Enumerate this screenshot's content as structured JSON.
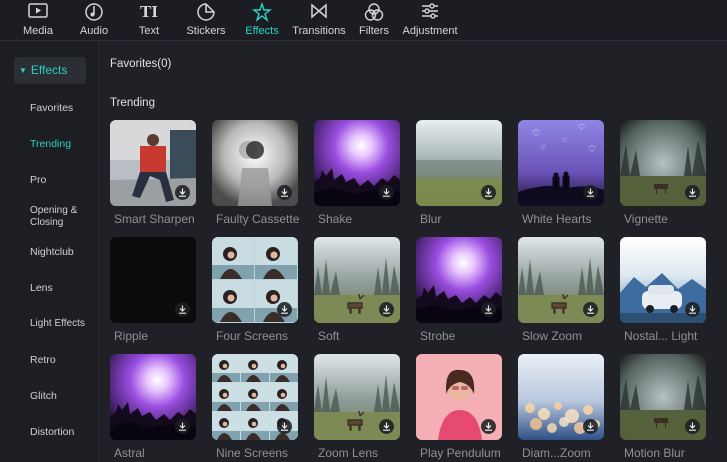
{
  "toolbar": {
    "tabs": [
      {
        "label": "Media",
        "icon": "media-icon"
      },
      {
        "label": "Audio",
        "icon": "audio-icon"
      },
      {
        "label": "Text",
        "icon": "text-icon"
      },
      {
        "label": "Stickers",
        "icon": "stickers-icon"
      },
      {
        "label": "Effects",
        "icon": "effects-icon",
        "active": true
      },
      {
        "label": "Transitions",
        "icon": "transitions-icon"
      },
      {
        "label": "Filters",
        "icon": "filters-icon"
      },
      {
        "label": "Adjustment",
        "icon": "adjustment-icon"
      }
    ]
  },
  "sidebar": {
    "header": "Effects",
    "items": [
      {
        "label": "Favorites"
      },
      {
        "label": "Trending",
        "active": true
      },
      {
        "label": "Pro"
      },
      {
        "label": "Opening & Closing"
      },
      {
        "label": "Nightclub"
      },
      {
        "label": "Lens"
      },
      {
        "label": "Light Effects"
      },
      {
        "label": "Retro"
      },
      {
        "label": "Glitch"
      },
      {
        "label": "Distortion"
      }
    ]
  },
  "main": {
    "favorites_label": "Favorites(0)",
    "trending_label": "Trending",
    "effects": [
      {
        "name": "Smart Sharpen",
        "thumb": "portrait-street"
      },
      {
        "name": "Faulty Cassette",
        "thumb": "portrait-glitch"
      },
      {
        "name": "Shake",
        "thumb": "concert-purple"
      },
      {
        "name": "Blur",
        "thumb": "field-blur"
      },
      {
        "name": "White Hearts",
        "thumb": "hearts-couple"
      },
      {
        "name": "Vignette",
        "thumb": "forest-deer-dark"
      },
      {
        "name": "Ripple",
        "thumb": "black"
      },
      {
        "name": "Four Screens",
        "thumb": "woman-grid-4"
      },
      {
        "name": "Soft",
        "thumb": "forest-deer"
      },
      {
        "name": "Strobe",
        "thumb": "concert-purple"
      },
      {
        "name": "Slow Zoom",
        "thumb": "forest-deer"
      },
      {
        "name": "Nostal... Light",
        "thumb": "car-mountains"
      },
      {
        "name": "Astral",
        "thumb": "concert-purple"
      },
      {
        "name": "Nine Screens",
        "thumb": "woman-grid-9"
      },
      {
        "name": "Zoom Lens",
        "thumb": "forest-deer"
      },
      {
        "name": "Play Pendulum",
        "thumb": "woman-pink"
      },
      {
        "name": "Diam...Zoom",
        "thumb": "bokeh-city"
      },
      {
        "name": "Motion Blur",
        "thumb": "forest-deer-dark"
      }
    ]
  },
  "colors": {
    "accent": "#28d0c3",
    "background": "#1f2126",
    "toolbar": "#1b1d22"
  }
}
